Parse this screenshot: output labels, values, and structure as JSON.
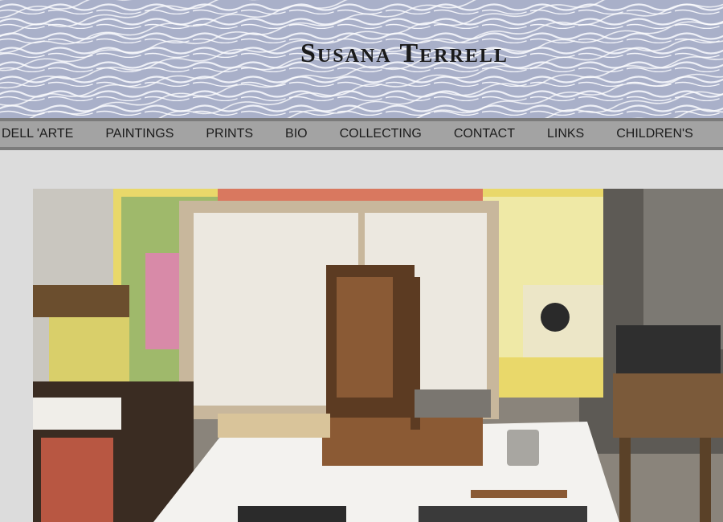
{
  "header": {
    "site_title": "Susana Terrell"
  },
  "nav": {
    "items": [
      {
        "label": "DELL 'ARTE"
      },
      {
        "label": "PAINTINGS"
      },
      {
        "label": "PRINTS"
      },
      {
        "label": "BIO"
      },
      {
        "label": "COLLECTING"
      },
      {
        "label": "CONTACT"
      },
      {
        "label": "LINKS"
      },
      {
        "label": "CHILDREN'S"
      }
    ]
  },
  "colors": {
    "banner_bg": "#a9b0c9",
    "nav_bg": "#a3a3a3",
    "nav_border": "#7b7b7b",
    "page_bg": "#dcdcdc"
  }
}
